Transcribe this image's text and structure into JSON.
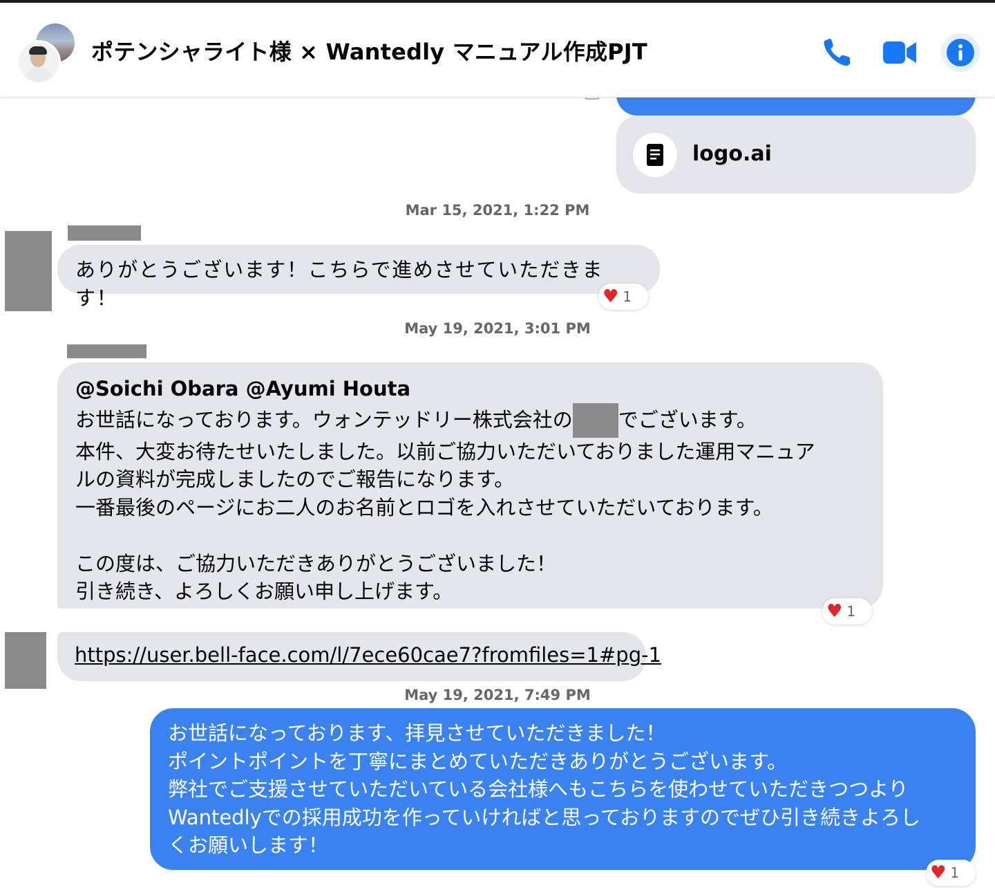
{
  "header": {
    "title": "ポテンシャライト様 × Wantedly マニュアル作成PJT",
    "actions": {
      "call_icon": "phone-icon",
      "video_icon": "video-camera-icon",
      "info_icon": "info-icon"
    }
  },
  "colors": {
    "accent": "#3a82f0",
    "incoming_bubble": "#e4e6eb",
    "timestamp": "#65676b",
    "heart": "#e0262b"
  },
  "messages": {
    "file": {
      "name": "logo.ai",
      "icon": "document-icon"
    },
    "ts1": "Mar 15, 2021, 1:22 PM",
    "msg1": {
      "text": "ありがとうございます！こちらで進めさせていただきます！",
      "reaction_count": "1"
    },
    "ts2": "May 19, 2021, 3:01 PM",
    "msg2": {
      "mentions": "@Soichi Obara @Ayumi Houta",
      "line1_before": "お世話になっております。ウォンテッドリー株式会社の",
      "line1_after": "でございます。",
      "body": "本件、大変お待たせいたしました。以前ご協力いただいておりました運用マニュア\nルの資料が完成しましたのでご報告になります。\n一番最後のページにお二人のお名前とロゴを入れさせていただいております。\n\nこの度は、ご協力いただきありがとうございました！\n引き続き、よろしくお願い申し上げます。",
      "reaction_count": "1"
    },
    "msg3": {
      "link": "https://user.bell-face.com/l/7ece60cae7?fromfiles=1#pg-1"
    },
    "ts3": "May 19, 2021, 7:49 PM",
    "msg4": {
      "text": "お世話になっております、拝見させていただきました！\nポイントポイントを丁寧にまとめていただきありがとうございます。\n弊社でご支援させていただいている会社様へもこちらを使わせていただきつつより\nWantedlyでの採用成功を作っていければと思っておりますのでぜひ引き続きよろし\nくお願いします！",
      "reaction_count": "1"
    }
  }
}
